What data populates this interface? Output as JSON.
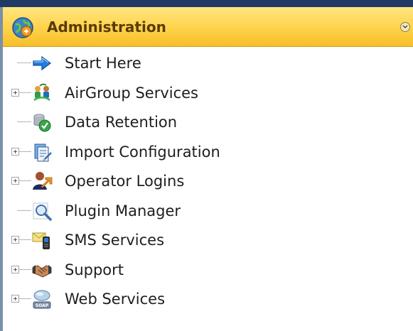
{
  "header": {
    "title": "Administration",
    "icon": "admin-globe-icon",
    "collapse_icon": "chevron-circle-icon"
  },
  "tree": {
    "items": [
      {
        "label": "Start Here",
        "icon": "arrow-right-icon",
        "expandable": false
      },
      {
        "label": "AirGroup Services",
        "icon": "airgroup-icon",
        "expandable": true
      },
      {
        "label": "Data Retention",
        "icon": "data-retention-icon",
        "expandable": false
      },
      {
        "label": "Import Configuration",
        "icon": "import-config-icon",
        "expandable": true
      },
      {
        "label": "Operator Logins",
        "icon": "operator-logins-icon",
        "expandable": true
      },
      {
        "label": "Plugin Manager",
        "icon": "magnifier-icon",
        "expandable": false
      },
      {
        "label": "SMS Services",
        "icon": "sms-phone-icon",
        "expandable": true
      },
      {
        "label": "Support",
        "icon": "handshake-icon",
        "expandable": true
      },
      {
        "label": "Web Services",
        "icon": "soap-icon",
        "expandable": true
      }
    ]
  },
  "colors": {
    "header_top": "#ffe680",
    "header_bottom": "#f7be29",
    "header_text": "#5a3a07",
    "frame": "#1f3a64"
  }
}
